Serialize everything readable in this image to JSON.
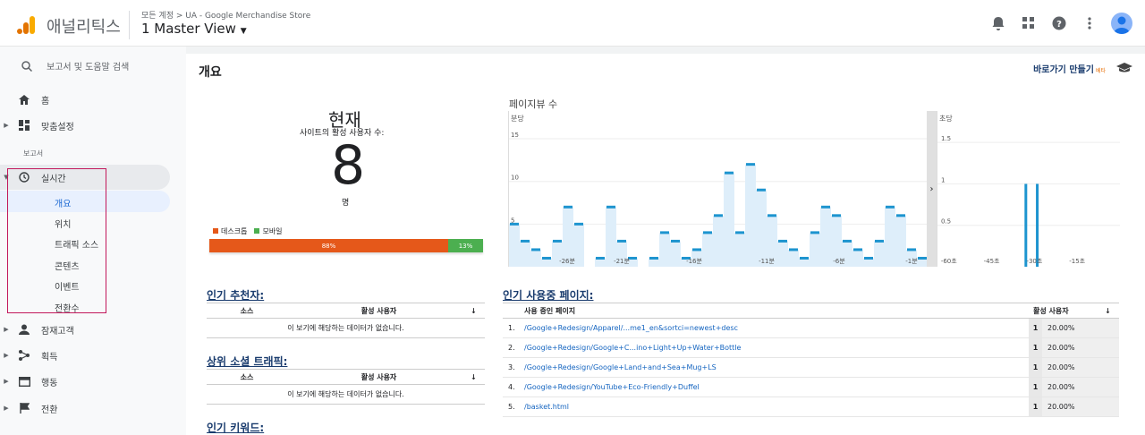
{
  "header": {
    "app_name": "애널리틱스",
    "breadcrumb": "모든 계정 > UA - Google Merchandise Store",
    "view": "1 Master View"
  },
  "sidebar": {
    "search": "보고서 및 도움말 검색",
    "home": "홈",
    "custom": "맞춤설정",
    "reports_section": "보고서",
    "realtime": "실시간",
    "realtime_items": [
      "개요",
      "위치",
      "트래픽 소스",
      "콘텐츠",
      "이벤트",
      "전환수"
    ],
    "audience": "잠재고객",
    "acquisition": "획득",
    "behavior": "행동",
    "conversions": "전환"
  },
  "main": {
    "title": "개요",
    "shortcut": "바로가기 만들기",
    "beta": "베타",
    "now": "현재",
    "active_users_label": "사이트의 활성 사용자 수:",
    "active_users": "8",
    "unit": "명",
    "device_legend": [
      {
        "label": "데스크톱",
        "color": "#e5581a"
      },
      {
        "label": "모바일",
        "color": "#4caf50"
      }
    ],
    "desktop_pct": "88%",
    "mobile_pct": "13%",
    "pageviews_title": "페이지뷰 수",
    "per_minute": "분당",
    "per_second": "초당",
    "referrers_title": "인기 추천자:",
    "social_title": "상위 소셜 트래픽:",
    "keywords_title": "인기 키워드:",
    "col_source": "소스",
    "col_active": "활성 사용자",
    "empty": "이 보기에 해당하는 데이터가 없습니다.",
    "pages_title": "인기 사용중 페이지:",
    "col_page": "사용 중인 페이지",
    "pages": [
      {
        "n": "1.",
        "url": "/Google+Redesign/Apparel/...me1_en&sortci=newest+desc",
        "count": "1",
        "pct": "20.00%"
      },
      {
        "n": "2.",
        "url": "/Google+Redesign/Google+C...ino+Light+Up+Water+Bottle",
        "count": "1",
        "pct": "20.00%"
      },
      {
        "n": "3.",
        "url": "/Google+Redesign/Google+Land+and+Sea+Mug+LS",
        "count": "1",
        "pct": "20.00%"
      },
      {
        "n": "4.",
        "url": "/Google+Redesign/YouTube+Eco-Friendly+Duffel",
        "count": "1",
        "pct": "20.00%"
      },
      {
        "n": "5.",
        "url": "/basket.html",
        "count": "1",
        "pct": "20.00%"
      }
    ]
  },
  "chart_data": [
    {
      "type": "line",
      "title": "분당",
      "y_ticks": [
        "15",
        "10",
        "5"
      ],
      "x_ticks": [
        "-26분",
        "-21분",
        "-16분",
        "-11분",
        "-6분",
        "-1분"
      ],
      "ylim": [
        0,
        17
      ],
      "values": [
        5,
        3,
        2,
        1,
        3,
        7,
        5,
        0,
        1,
        7,
        3,
        1,
        0,
        1,
        4,
        3,
        1,
        2,
        4,
        6,
        11,
        4,
        12,
        9,
        6,
        3,
        2,
        1,
        4,
        7,
        6,
        3,
        2,
        1,
        3,
        7,
        6,
        2,
        1
      ]
    },
    {
      "type": "bar",
      "title": "초당",
      "y_ticks": [
        "1.5",
        "1",
        "0.5"
      ],
      "x_ticks": [
        "-60초",
        "-45초",
        "-30초",
        "-15초"
      ],
      "ylim": [
        0,
        1.75
      ],
      "bars": [
        {
          "x": -33,
          "y": 1
        },
        {
          "x": -29,
          "y": 1
        }
      ]
    }
  ]
}
